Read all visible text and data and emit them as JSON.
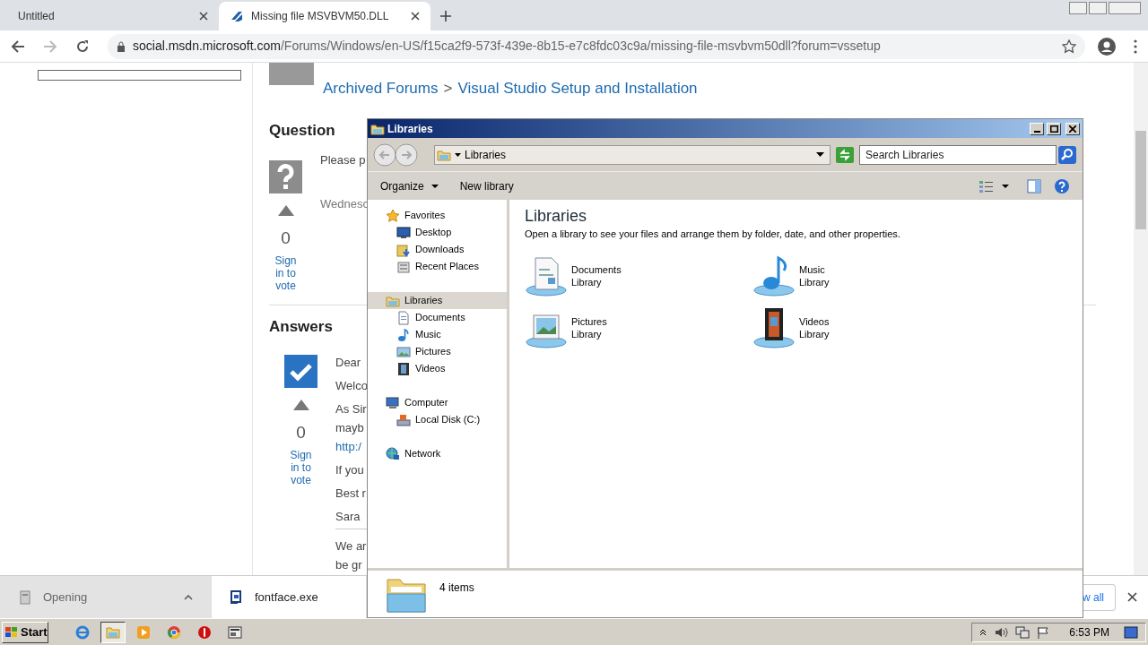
{
  "browser": {
    "tabs": [
      {
        "title": "Untitled",
        "selected": false
      },
      {
        "title": "Missing file MSVBVM50.DLL",
        "selected": true
      }
    ],
    "url": {
      "host": "social.msdn.microsoft.com",
      "path": "/Forums/Windows/en-US/f15ca2f9-573f-439e-8b15-e7c8fdc03c9a/missing-file-msvbvm50dll?forum=vssetup"
    }
  },
  "page": {
    "breadcrumb": [
      "Archived Forums",
      "Visual Studio Setup and Installation"
    ],
    "breadcrumb_separator": ">",
    "question": {
      "heading": "Question",
      "votes": "0",
      "vote_link": "Sign in to vote",
      "lines": [
        {
          "text": "Please p",
          "kind": "body"
        },
        {
          "text": "Wednesc",
          "kind": "date"
        }
      ]
    },
    "answers": {
      "heading": "Answers",
      "votes": "0",
      "vote_link": "Sign in to vote",
      "paragraphs": [
        {
          "kind": "text",
          "lines": [
            {
              "text": "Dear",
              "link": false
            }
          ]
        },
        {
          "kind": "text",
          "lines": [
            {
              "text": "Welco",
              "link": false
            }
          ]
        },
        {
          "kind": "text",
          "lines": [
            {
              "text": "As Sir",
              "link": false
            },
            {
              "text": "mayb",
              "link": false
            },
            {
              "text": "http:/",
              "link": true
            }
          ]
        },
        {
          "kind": "text",
          "lines": [
            {
              "text": "If you",
              "link": false
            }
          ]
        },
        {
          "kind": "text",
          "lines": [
            {
              "text": "Best r",
              "link": false
            }
          ]
        },
        {
          "kind": "text",
          "lines": [
            {
              "text": "Sara",
              "link": false
            }
          ]
        },
        {
          "kind": "divider"
        },
        {
          "kind": "text",
          "lines": [
            {
              "text": "We ar",
              "link": false
            },
            {
              "text": "be gr",
              "link": false
            }
          ]
        }
      ]
    }
  },
  "download_bar": {
    "items": [
      {
        "label": "Opening",
        "kind": "progress",
        "selected": true
      },
      {
        "label": "fontface.exe",
        "kind": "file",
        "selected": false
      }
    ],
    "show_all": "w all"
  },
  "explorer": {
    "title": "Libraries",
    "address": "Libraries",
    "search_placeholder": "Search Libraries",
    "toolbar": [
      {
        "label": "Organize",
        "dropdown": true
      },
      {
        "label": "New library",
        "dropdown": false
      }
    ],
    "nav": [
      {
        "label": "Favorites",
        "kind": "star",
        "selected": false,
        "children": [
          {
            "label": "Desktop",
            "kind": "desktop",
            "selected": false
          },
          {
            "label": "Downloads",
            "kind": "downloads",
            "selected": false
          },
          {
            "label": "Recent Places",
            "kind": "recent",
            "selected": false
          }
        ]
      },
      {
        "label": "Libraries",
        "kind": "library",
        "selected": true,
        "children": [
          {
            "label": "Documents",
            "kind": "document",
            "selected": false
          },
          {
            "label": "Music",
            "kind": "music",
            "selected": false
          },
          {
            "label": "Pictures",
            "kind": "picture",
            "selected": false
          },
          {
            "label": "Videos",
            "kind": "video",
            "selected": false
          }
        ]
      },
      {
        "label": "Computer",
        "kind": "computer",
        "selected": false,
        "children": [
          {
            "label": "Local Disk (C:)",
            "kind": "disk",
            "selected": false
          }
        ]
      },
      {
        "label": "Network",
        "kind": "network",
        "selected": false
      }
    ],
    "heading": "Libraries",
    "description": "Open a library to see your files and arrange them by folder, date, and other properties.",
    "libraries": [
      {
        "name": "Documents",
        "subtitle": "Library",
        "kind": "document"
      },
      {
        "name": "Music",
        "subtitle": "Library",
        "kind": "music"
      },
      {
        "name": "Pictures",
        "subtitle": "Library",
        "kind": "picture"
      },
      {
        "name": "Videos",
        "subtitle": "Library",
        "kind": "video"
      }
    ],
    "status": "4 items"
  },
  "taskbar": {
    "start": "Start",
    "apps": [
      {
        "kind": "ie",
        "active": false
      },
      {
        "kind": "explorer",
        "active": true
      },
      {
        "kind": "media",
        "active": false
      },
      {
        "kind": "chrome",
        "active": false
      },
      {
        "kind": "alert",
        "active": false
      },
      {
        "kind": "app",
        "active": false
      }
    ],
    "clock": "6:53 PM"
  }
}
